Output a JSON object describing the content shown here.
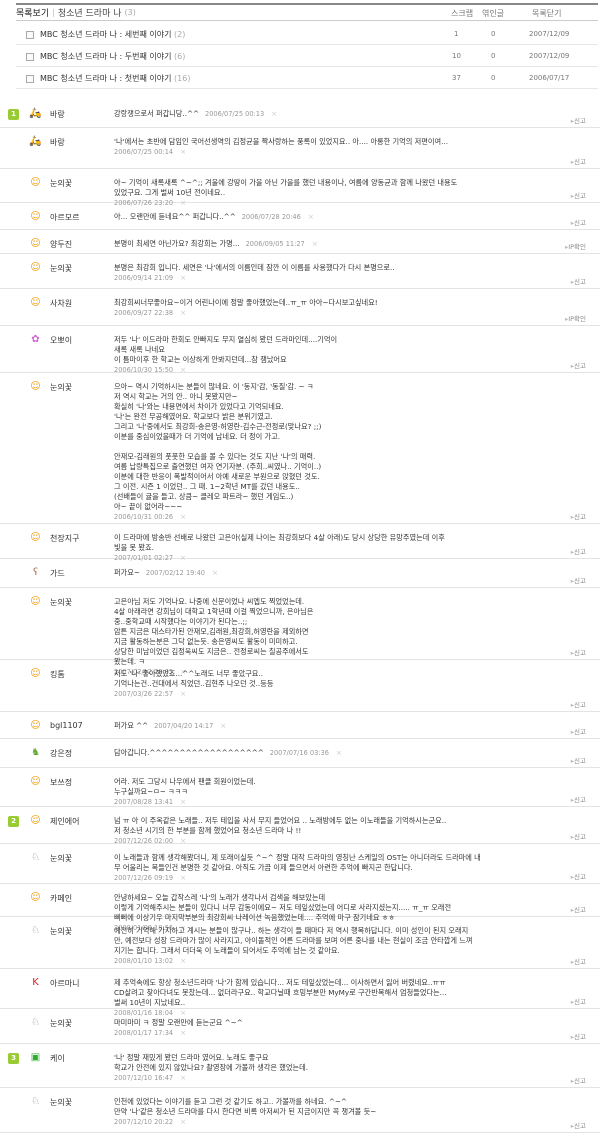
{
  "header": {
    "list_label": "목록보기",
    "title": "청소년 드라마 나",
    "title_count": "(3)",
    "col_scrap": "스크랩",
    "col_comment": "엮인글",
    "close_label": "목록닫기"
  },
  "posts": [
    {
      "title": "MBC 청소년 드라마 나 : 세번째 이야기",
      "count": "(2)",
      "scrap": "1",
      "trackback": "0",
      "date": "2007/12/09"
    },
    {
      "title": "MBC 청소년 드라마 나 : 두번째 이야기",
      "count": "(6)",
      "scrap": "10",
      "trackback": "0",
      "date": "2007/12/09"
    },
    {
      "title": "MBC 청소년 드라마 나 : 첫번째 이야기",
      "count": "(16)",
      "scrap": "37",
      "trackback": "0",
      "date": "2006/07/17"
    }
  ],
  "actions": {
    "report": "신고",
    "ip": "IP확인"
  },
  "comments": [
    {
      "num": "1",
      "name": "바랑",
      "avatar": "scooter-icon",
      "text": [
        "강랑쟁으로서 퍼갑니당..^^"
      ],
      "date": "2006/07/25 00:13",
      "act": "report"
    },
    {
      "name": "바랑",
      "avatar": "scooter-icon",
      "text": [
        "'나'에서는 초반에 담임인 국어선생역의 김정균을 짝사랑하는 풍록이 있었지요.. 아.... 아롱한 기억의 저편이여..."
      ],
      "date": "2006/07/25 00:14",
      "act": "report"
    },
    {
      "name": "눈의꽃",
      "avatar": "face-icon",
      "text": [
        "아~ 기억이 새록새록 ^~^;; 겨울에 강땅이 가을 아닌 가을를 했던 내용이나, 여름에 양동균과 함께 나왔던 내용도",
        "있었구요. 그게 벌써 10년 전이네요.."
      ],
      "date": "2006/07/26 23:20",
      "act": "report"
    },
    {
      "name": "아르모르",
      "avatar": "face-icon",
      "text": [
        "아... 오랜만에 듣네요^^ 퍼갑니다..^^"
      ],
      "date": "2006/07/28 20:46",
      "act": "report"
    },
    {
      "name": "양두진",
      "avatar": "face-icon",
      "text": [
        "분명이 최세연 아닌가요? 최강희는 가명..."
      ],
      "date": "2006/09/05 11:27",
      "act": "ip"
    },
    {
      "name": "눈의꽃",
      "avatar": "face-icon",
      "text": [
        "분명은 최강희 입니다. 세연은 '나'에서의 이름인데 잠깐 이 이름를 사용했다가 다시 본명으로.."
      ],
      "date": "2006/09/14 21:09",
      "act": "report"
    },
    {
      "name": "사차원",
      "avatar": "face-icon",
      "text": [
        "최강희씨너무좋아요~이거 어린나이에 정말 좋아했었는데..ㅠ_ㅠ 아아~다시보고싶네요!"
      ],
      "date": "2006/09/27 22:38",
      "act": "ip"
    },
    {
      "name": "오뽀이",
      "avatar": "flower-icon",
      "text": [
        "저두 '나' 이드라마 한회도 안빠지도 무지 열심히 봤던 드라마인데....기억이",
        "새록 새록 나네요",
        "이 틈마이후 한 학교는 이상하게 안봐지던데...참 잼났어요"
      ],
      "date": "2006/10/30 15:50",
      "act": "report"
    },
    {
      "name": "눈의꽃",
      "avatar": "face-icon",
      "text": [
        "으아~ 역시 기억하시는 분들이 많네요. 이 '동지'감, '동질'감. ~ ㅋ",
        "저 역시 학교는 거의 안.. 아니 못봤지만~",
        "확실히 '나'와는 내용면에서 차이가 있었다고 기억되네요.",
        "'나'는 완전 무공해였어요. 학교보다 밝은 분위기였고.",
        "그리고 '나'중에서도 최강희-송은영-허영란-김수근-전정로(맞나요? ;;)",
        "이분를 중심이었을때가 더 기억에 남네요. 더 정이 가고.",
        "",
        "안재모-김래원의 풋풋한 모습를 볼 수 있다는 것도 지난 '나'의 매력.",
        "여름 납량특집으로 출연했던 여자 연기자분. (주희..씨였나.. 기억이..)",
        "이분에 대한 반응이 폭발적이어서 아예 새로운 부원으로 앉혔던 것도.",
        "그 이전. 시즌 1 이었던.. 그 때. 1~2학년 MT를 갔던 내용도..",
        "(선배들이 귤을 들고. 상큼~ 클레오 파트라~ 했던 게임도..)",
        "아~ 끝이 없어라~~~"
      ],
      "date": "2006/10/31 00:26",
      "act": "report"
    },
    {
      "name": "천장지구",
      "avatar": "face-icon",
      "text": [
        "이 드라마에 방송반 선배로 나왔던 고은아(실제 나이는 최강희보다 4살 아래)도 당시 상당한 유망주였는데 이후",
        "빛을 못 봤죠."
      ],
      "date": "2007/01/01 02:27",
      "act": "report"
    },
    {
      "name": "가드",
      "avatar": "bear-icon",
      "text": [
        "퍼가요~"
      ],
      "date": "2007/02/12 19:40",
      "act": "report"
    },
    {
      "name": "눈의꽃",
      "avatar": "face-icon",
      "text": [
        "고은아님 저도 기억나요. 나중에 신문이었나 씨엡도 찍었었는데.",
        "4살 아래라면 강희님이 대학교 1학년때 이걸 찍었으니까, 은아님은",
        "중..중학교때 시작했다는 이야기가 된다는..;;",
        "암튼 지금은 대스타가된 안재모,김래원,최강희,허영란을 제외하면",
        "지금 활동하는분은 그닥 없는듯. 송은영씨도 활동이 미미하고.",
        "상당한 미남이었던 김정욱씨도 지금은.. 전정로씨는 칠공주에서도",
        "봤는데. ㅋ"
      ],
      "date": "2007/02/12 20:05",
      "act": "report"
    },
    {
      "name": "킹톰",
      "avatar": "face-icon",
      "text": [
        "저도 '나' 좋아했었죠...^^노래도 너무 좋았구요..",
        "기억나는건..건대에서 직었던..김현주 나오던 것..등등"
      ],
      "date": "2007/03/26 22:57",
      "act": "report"
    },
    {
      "name": "bgl1107",
      "avatar": "face-icon",
      "text": [
        "퍼가요 ^^"
      ],
      "date": "2007/04/20 14:17",
      "act": "report"
    },
    {
      "name": "강은정",
      "avatar": "rabbit-icon",
      "text": [
        "담아갑니다.^^^^^^^^^^^^^^^^^^^"
      ],
      "date": "2007/07/16 03:36",
      "act": "report"
    },
    {
      "name": "보쓰정",
      "avatar": "face-icon",
      "text": [
        "어라. 저도 그당시 나우에서 팬클 회원이었는데.",
        "누구실까요~ㅁ~ ㅋㅋㅋ"
      ],
      "date": "2007/08/28 13:41",
      "act": "report"
    },
    {
      "num": "2",
      "name": "제인에어",
      "avatar": "face-icon",
      "text": [
        "넘 ㅠ 아 이 주옥같은 노래들.. 저두 테입을 사서 무지 들었어요 .. 노래방에두 없는 이노래들을 기억하시는군요..",
        "저 청소년 시기의 한 부분를 함께 했었어요 청소년 드라마 나 !!"
      ],
      "date": "2007/12/26 02:00",
      "act": "report"
    },
    {
      "name": "눈의꽃",
      "avatar": "dog-icon",
      "text": [
        "이 노래들과 함께 생각해봤더니, 제 또래이실듯 ^~^ 정말 대작 드라마의 영칭난 스케일의 OST는 아니더라도 드라마에 내",
        "무 어울리는 목들인건 분명한 것 같아요. 아직도 가끔 이제 들으면서 아련한 추억에 빠지곤 한답니다."
      ],
      "date": "2007/12/26 09:19",
      "act": "report"
    },
    {
      "name": "카페인",
      "avatar": "face-icon",
      "text": [
        "안녕하세요~ 오늘 갑작스레 '나'의 노래가 생각나서 검색을 해보았는데",
        "이렇게 기억해주시는 분들이 있다니 너무 감동이에요~ 저도 테잎샀었는데 어디로 사라지셨는지..... ㅠ_ㅠ 오래전",
        "삐삐에 이상기우 마지막부분의 최강희씨 나레이션 녹음했었는데.... 추억에 마구 잠기네요 ㅎㅎ"
      ],
      "date": "2008/01/08 18:56",
      "act": "report"
    },
    {
      "name": "눈의꽃",
      "avatar": "dog-icon",
      "text": [
        "예전히 기억해 가지하고 계시는 분들이 많구나.. 하는 생각이 들 때마다 저 역시 행복하답니다. 이미 성인이 된지 오래지",
        "만, 예전보다 성장 드라마가 많이 사라지고, 아이돌적인 어른 드라마를 보며 어른 중나를 내는 현실이 조금 안타깝게 느껴",
        "지기는 합니다. 그래서 더더욱 이 노래들이 되어서도 추억에 남는 것 같아요."
      ],
      "date": "2008/01/10 13:02",
      "act": "report"
    },
    {
      "name": "아르마니",
      "avatar": "kin-icon",
      "text": [
        "제 추억속에도 항상 청소년드라마 '나'가 함께 있습니다... 저도 테잎샀었는데... 이사하면서 잃어 버렸네요..ㅠㅠ",
        "CD살려고 찾아다녀도 못찼는데... 없더라구요.. 학교다닐때 흐밍부분만 MyMy로 구간반복해서 엄청들었다는...",
        "벌써 10년이 지났네요.."
      ],
      "date": "2008/01/16 18:04",
      "act": "report"
    },
    {
      "name": "눈의꽃",
      "avatar": "dog-icon",
      "text": [
        "마미마미 ㅋ 정말 오랜만에 듣는군요 ^~^"
      ],
      "date": "2008/01/17 17:34",
      "act": "report"
    },
    {
      "num": "3",
      "name": "케이",
      "avatar": "square-icon",
      "text": [
        "'나' 정말 재밌게 봤던 드라마 였어요. 노래도 좋구요",
        "학교가 안전에 있지 않았나요? 촬영장에 가볼까 생각은 했었는데."
      ],
      "date": "2007/12/10 16:47",
      "act": "report"
    },
    {
      "name": "눈의꽃",
      "avatar": "dog-icon",
      "text": [
        "인천에 있었다는 이야기를 듣고 그런 것 같기도 하고.. 가볼까를 하네요. ^~^",
        "만약 '나'같은 청소년 드라마를 다시 한다면 비록 아저씨가 된 지금이지만 꼭 챙겨볼 듯~"
      ],
      "date": "2007/12/10 20:22",
      "act": "report"
    }
  ]
}
